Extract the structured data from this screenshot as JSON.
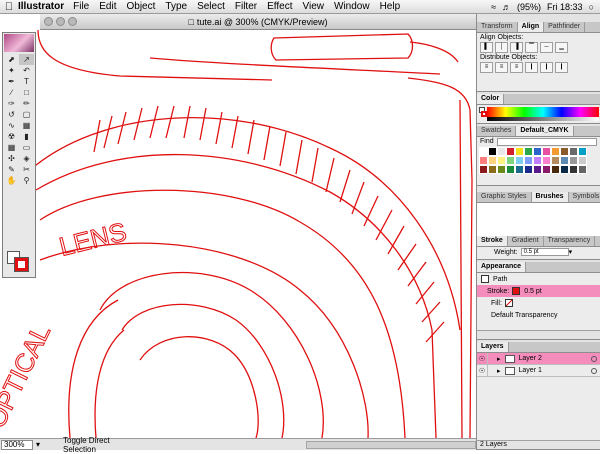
{
  "menubar": {
    "apple_icon": "apple-icon",
    "app": "Illustrator",
    "items": [
      "File",
      "Edit",
      "Object",
      "Type",
      "Select",
      "Filter",
      "Effect",
      "View",
      "Window",
      "Help"
    ],
    "battery": "(95%)",
    "clock": "Fri 18:33"
  },
  "window": {
    "title": "tute.ai @ 300% (CMYK/Preview)"
  },
  "artwork": {
    "text1": "LENS",
    "text2": "OPTICAL"
  },
  "status": {
    "zoom": "300%",
    "tool": "Toggle Direct Selection"
  },
  "align": {
    "tabs": [
      "Transform",
      "Align",
      "Pathfinder"
    ],
    "align_label": "Align Objects:",
    "distribute_label": "Distribute Objects:"
  },
  "color": {
    "title": "Color"
  },
  "swatches": {
    "tabs": [
      "Swatches",
      "Default_CMYK"
    ],
    "find": "Find",
    "colors": [
      "#ffffff",
      "#000000",
      "#e8e8e8",
      "#d11f2b",
      "#f4e21b",
      "#2aa84a",
      "#2a63c9",
      "#e84fa0",
      "#f39b2e",
      "#8b5a2b",
      "#6a6a6a",
      "#00a0c6",
      "#ff7f7f",
      "#ffd27f",
      "#fff27f",
      "#7fd67f",
      "#7fd0f0",
      "#7f9fff",
      "#c07fff",
      "#ff7fd0",
      "#b38b5d",
      "#5d8bb3",
      "#999999",
      "#cccccc",
      "#8b1a1a",
      "#8b6a1a",
      "#6a8b1a",
      "#1a8b3a",
      "#1a6a8b",
      "#1a2a8b",
      "#5a1a8b",
      "#8b1a6a",
      "#4a2a0a",
      "#0a2a4a",
      "#333333",
      "#666666"
    ]
  },
  "brushes": {
    "tabs": [
      "Graphic Styles",
      "Brushes",
      "Symbols"
    ]
  },
  "stroke": {
    "tabs": [
      "Stroke",
      "Gradient",
      "Transparency"
    ],
    "weight_label": "Weight:",
    "weight_value": "0.5 pt"
  },
  "appearance": {
    "title": "Appearance",
    "path": "Path",
    "stroke_label": "Stroke:",
    "stroke_value": "0.5 pt",
    "fill_label": "Fill:",
    "transparency": "Default Transparency"
  },
  "layers": {
    "title": "Layers",
    "items": [
      "Layer 2",
      "Layer 1"
    ],
    "count": "2 Layers"
  },
  "colors": {
    "stroke": "#e01010",
    "highlight": "#f48cbc"
  }
}
